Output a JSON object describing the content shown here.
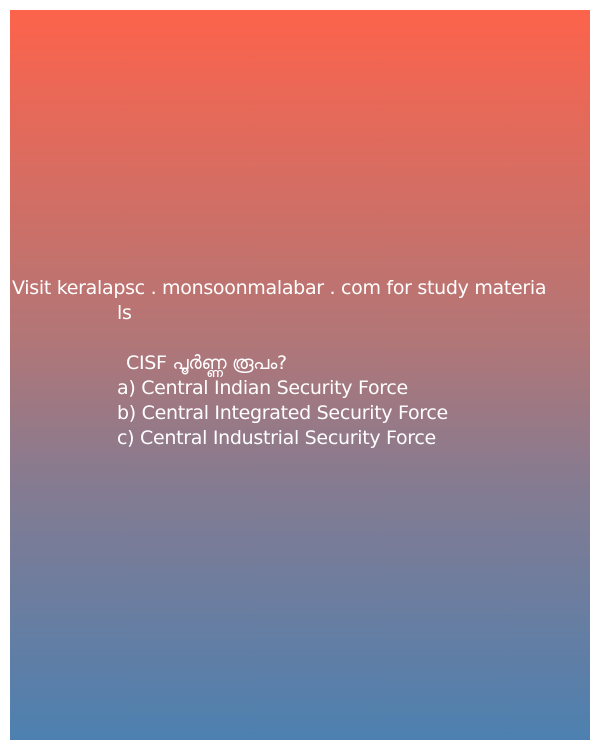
{
  "promo": {
    "line1": "Visit keralapsc . monsoonmalabar . com for study materia",
    "line2": "ls"
  },
  "question": {
    "text": "CISF പൂർണ്ണ രൂപം?",
    "options": [
      "a) Central Indian Security Force",
      "b) Central Integrated Security  Force",
      "c) Central Industrial Security Force"
    ]
  },
  "colors": {
    "gradient_top": "#fd634b",
    "gradient_bottom": "#4d80b0",
    "text": "#ffffff"
  }
}
